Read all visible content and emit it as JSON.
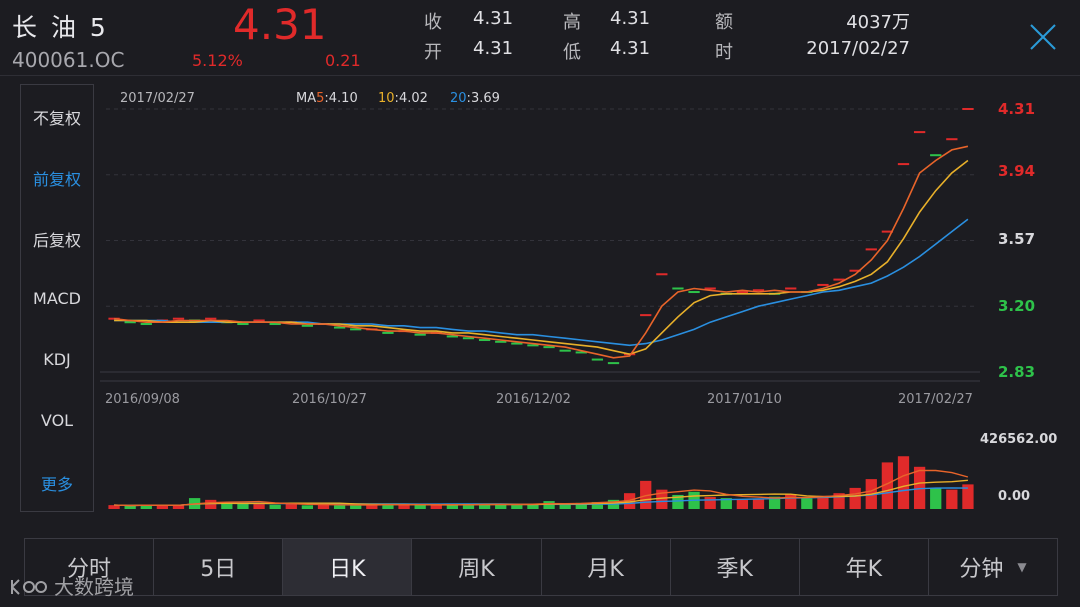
{
  "header": {
    "name": "长 油 5",
    "code": "400061.OC",
    "price": "4.31",
    "change_pct": "5.12%",
    "change": "0.21",
    "quotes": [
      {
        "label": "收",
        "value": "4.31"
      },
      {
        "label": "高",
        "value": "4.31"
      },
      {
        "label": "额",
        "value": "4037万"
      },
      {
        "label": "开",
        "value": "4.31"
      },
      {
        "label": "低",
        "value": "4.31"
      },
      {
        "label": "时",
        "value": "2017/02/27"
      }
    ]
  },
  "menu": [
    "不复权",
    "前复权",
    "后复权",
    "MACD",
    "KDJ",
    "VOL",
    "更多"
  ],
  "menu_active": 1,
  "tabs": [
    "分时",
    "5日",
    "日K",
    "周K",
    "月K",
    "季K",
    "年K",
    "分钟"
  ],
  "tab_active": 2,
  "watermark": "大数跨境",
  "colors": {
    "up": "#e02a2a",
    "down": "#2ec24a",
    "ma5": "#e8642a",
    "ma10": "#e8b02a",
    "ma20": "#2a8fe0"
  },
  "chart_data": {
    "type": "candlestick",
    "date_label": "2017/02/27",
    "ma_legend": {
      "prefix": "MA",
      "ma5_label": "5",
      "ma5": "4.10",
      "ma10_label": "10",
      "ma10": "4.02",
      "ma20_label": "20",
      "ma20": "3.69"
    },
    "price_axis": [
      "4.31",
      "3.94",
      "3.57",
      "3.20",
      "2.83"
    ],
    "price_range": [
      2.83,
      4.31
    ],
    "date_axis": [
      "2016/09/08",
      "2016/10/27",
      "2016/12/02",
      "2017/01/10",
      "2017/02/27"
    ],
    "volume_axis": [
      "426562.00",
      "0.00"
    ],
    "volume_max": 426562,
    "ma5": [
      3.13,
      3.12,
      3.11,
      3.11,
      3.12,
      3.12,
      3.12,
      3.12,
      3.11,
      3.11,
      3.11,
      3.1,
      3.1,
      3.1,
      3.09,
      3.08,
      3.07,
      3.06,
      3.06,
      3.05,
      3.05,
      3.04,
      3.03,
      3.02,
      3.01,
      3.0,
      2.99,
      2.98,
      2.97,
      2.95,
      2.93,
      2.91,
      2.92,
      3.05,
      3.2,
      3.28,
      3.3,
      3.29,
      3.28,
      3.29,
      3.28,
      3.29,
      3.28,
      3.28,
      3.3,
      3.33,
      3.38,
      3.46,
      3.57,
      3.75,
      3.95,
      4.02,
      4.08,
      4.1
    ],
    "ma10": [
      3.12,
      3.12,
      3.12,
      3.11,
      3.11,
      3.11,
      3.12,
      3.11,
      3.11,
      3.11,
      3.11,
      3.11,
      3.1,
      3.1,
      3.1,
      3.09,
      3.09,
      3.08,
      3.07,
      3.06,
      3.06,
      3.05,
      3.05,
      3.04,
      3.03,
      3.02,
      3.01,
      3.0,
      2.99,
      2.98,
      2.97,
      2.95,
      2.93,
      2.96,
      3.05,
      3.14,
      3.22,
      3.26,
      3.27,
      3.27,
      3.27,
      3.27,
      3.28,
      3.28,
      3.29,
      3.31,
      3.34,
      3.38,
      3.45,
      3.58,
      3.73,
      3.85,
      3.95,
      4.02
    ],
    "ma20": [
      3.12,
      3.12,
      3.12,
      3.12,
      3.11,
      3.11,
      3.11,
      3.11,
      3.11,
      3.11,
      3.11,
      3.11,
      3.11,
      3.1,
      3.1,
      3.1,
      3.1,
      3.09,
      3.09,
      3.08,
      3.08,
      3.07,
      3.06,
      3.06,
      3.05,
      3.04,
      3.04,
      3.03,
      3.02,
      3.01,
      3.0,
      2.99,
      2.98,
      2.99,
      3.01,
      3.04,
      3.07,
      3.11,
      3.14,
      3.17,
      3.2,
      3.22,
      3.24,
      3.26,
      3.28,
      3.29,
      3.31,
      3.33,
      3.37,
      3.42,
      3.48,
      3.55,
      3.62,
      3.69
    ],
    "closes": [
      3.13,
      3.11,
      3.1,
      3.12,
      3.13,
      3.12,
      3.13,
      3.11,
      3.1,
      3.12,
      3.1,
      3.11,
      3.09,
      3.1,
      3.08,
      3.07,
      3.07,
      3.05,
      3.06,
      3.04,
      3.05,
      3.03,
      3.02,
      3.01,
      3.0,
      2.99,
      2.98,
      2.97,
      2.95,
      2.94,
      2.9,
      2.88,
      2.93,
      3.15,
      3.38,
      3.3,
      3.28,
      3.3,
      3.27,
      3.28,
      3.29,
      3.27,
      3.3,
      3.28,
      3.32,
      3.35,
      3.4,
      3.52,
      3.62,
      4.0,
      4.18,
      4.05,
      4.14,
      4.31
    ],
    "volumes": [
      22000,
      18000,
      25000,
      20000,
      21000,
      62000,
      52000,
      38000,
      30000,
      28000,
      24000,
      32000,
      21000,
      23000,
      20000,
      22000,
      27000,
      30000,
      24000,
      22000,
      20000,
      26000,
      28000,
      31000,
      25000,
      22000,
      30000,
      45000,
      28000,
      35000,
      40000,
      52000,
      90000,
      160000,
      110000,
      80000,
      98000,
      68000,
      62000,
      52000,
      58000,
      70000,
      85000,
      60000,
      75000,
      90000,
      120000,
      170000,
      265000,
      300000,
      240000,
      120000,
      110000,
      140000
    ],
    "dates": [
      "2016/09/08",
      "2016/10/27",
      "2016/12/02",
      "2017/01/10",
      "2017/02/27"
    ]
  }
}
